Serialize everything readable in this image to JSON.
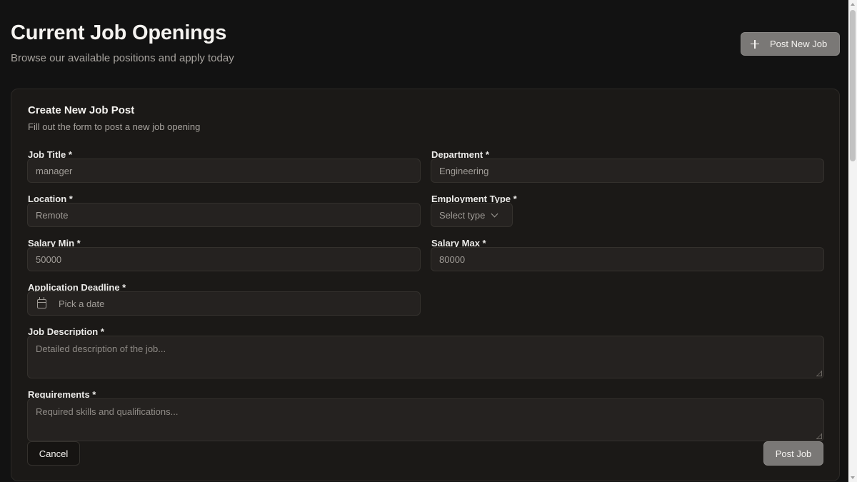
{
  "header": {
    "title": "Current Job Openings",
    "subtitle": "Browse our available positions and apply today",
    "post_new_label": "Post New Job",
    "post_new_icon": "plus-icon"
  },
  "form": {
    "title": "Create New Job Post",
    "description": "Fill out the form to post a new job opening",
    "job_title": {
      "label": "Job Title *",
      "value": "manager"
    },
    "department": {
      "label": "Department *",
      "value": "Engineering"
    },
    "location": {
      "label": "Location *",
      "value": "Remote"
    },
    "employment_type": {
      "label": "Employment Type *",
      "placeholder": "Select type",
      "icon": "chevron-down-icon"
    },
    "salary_min": {
      "label": "Salary Min *",
      "value": "50000"
    },
    "salary_max": {
      "label": "Salary Max *",
      "value": "80000"
    },
    "deadline": {
      "label": "Application Deadline *",
      "placeholder": "Pick a date",
      "icon": "calendar-icon"
    },
    "job_description": {
      "label": "Job Description *",
      "placeholder": "Detailed description of the job..."
    },
    "requirements": {
      "label": "Requirements *",
      "placeholder": "Required skills and qualifications..."
    },
    "cancel_label": "Cancel",
    "submit_label": "Post Job"
  },
  "colors": {
    "background": "#121212",
    "card": "#1b1917",
    "input": "#252220",
    "primary_button": "#7a7876"
  }
}
